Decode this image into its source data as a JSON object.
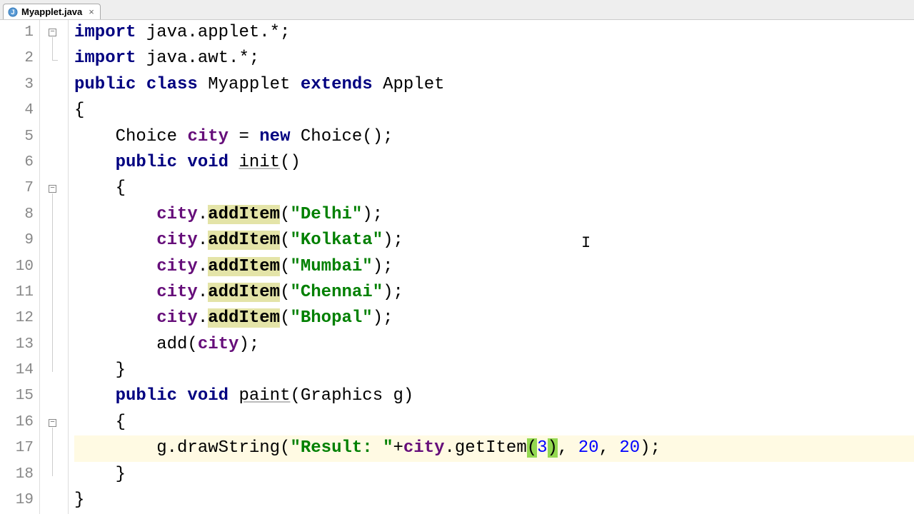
{
  "tab": {
    "filename": "Myapplet.java",
    "icon": "java-class-icon"
  },
  "line_numbers": [
    "1",
    "2",
    "3",
    "4",
    "5",
    "6",
    "7",
    "8",
    "9",
    "10",
    "11",
    "12",
    "13",
    "14",
    "15",
    "16",
    "17",
    "18",
    "19"
  ],
  "code": {
    "l1": {
      "kw1": "import",
      "pkg": " java.applet.*;"
    },
    "l2": {
      "kw1": "import",
      "pkg": " java.awt.*;"
    },
    "l3": {
      "kw1": "public class",
      "cls": " Myapplet ",
      "kw2": "extends",
      "sup": " Applet"
    },
    "l4": {
      "txt": "{"
    },
    "l5": {
      "p1": "    Choice ",
      "f": "city",
      "p2": " = ",
      "kw": "new",
      "p3": " Choice();"
    },
    "l6": {
      "p1": "    ",
      "kw": "public void",
      "m": "init",
      "p2": "()"
    },
    "l7": {
      "txt": "    {"
    },
    "l8": {
      "p1": "        ",
      "f": "city",
      "d": ".",
      "m": "addItem",
      "p2": "(",
      "s": "\"Delhi\"",
      "p3": ");"
    },
    "l9": {
      "p1": "        ",
      "f": "city",
      "d": ".",
      "m": "addItem",
      "p2": "(",
      "s": "\"Kolkata\"",
      "p3": ");"
    },
    "l10": {
      "p1": "        ",
      "f": "city",
      "d": ".",
      "m": "addItem",
      "p2": "(",
      "s": "\"Mumbai\"",
      "p3": ");"
    },
    "l11": {
      "p1": "        ",
      "f": "city",
      "d": ".",
      "m": "addItem",
      "p2": "(",
      "s": "\"Chennai\"",
      "p3": ");"
    },
    "l12": {
      "p1": "        ",
      "f": "city",
      "d": ".",
      "m": "addItem",
      "p2": "(",
      "s": "\"Bhopal\"",
      "p3": ");"
    },
    "l13": {
      "p1": "        add(",
      "f": "city",
      "p2": ");"
    },
    "l14": {
      "txt": "    }"
    },
    "l15": {
      "p1": "    ",
      "kw": "public void",
      "m": "paint",
      "p2": "(Graphics g)"
    },
    "l16": {
      "txt": "    {"
    },
    "l17": {
      "p1": "        g.drawString(",
      "s": "\"Result: \"",
      "p2": "+",
      "f": "city",
      "d": ".getItem",
      "b1": "(",
      "n": "3",
      "b2": ")",
      "p3": ", ",
      "n2": "20",
      "p4": ", ",
      "n3": "20",
      "p5": ");"
    },
    "l18": {
      "txt": "    }"
    },
    "l19": {
      "txt": "}"
    }
  },
  "colors": {
    "keyword": "#000080",
    "field": "#660e7a",
    "string": "#008000",
    "number": "#0000ff",
    "highlight_method": "#e4e4a8",
    "highlight_bracket": "#93d850",
    "current_line": "#fffae3"
  }
}
